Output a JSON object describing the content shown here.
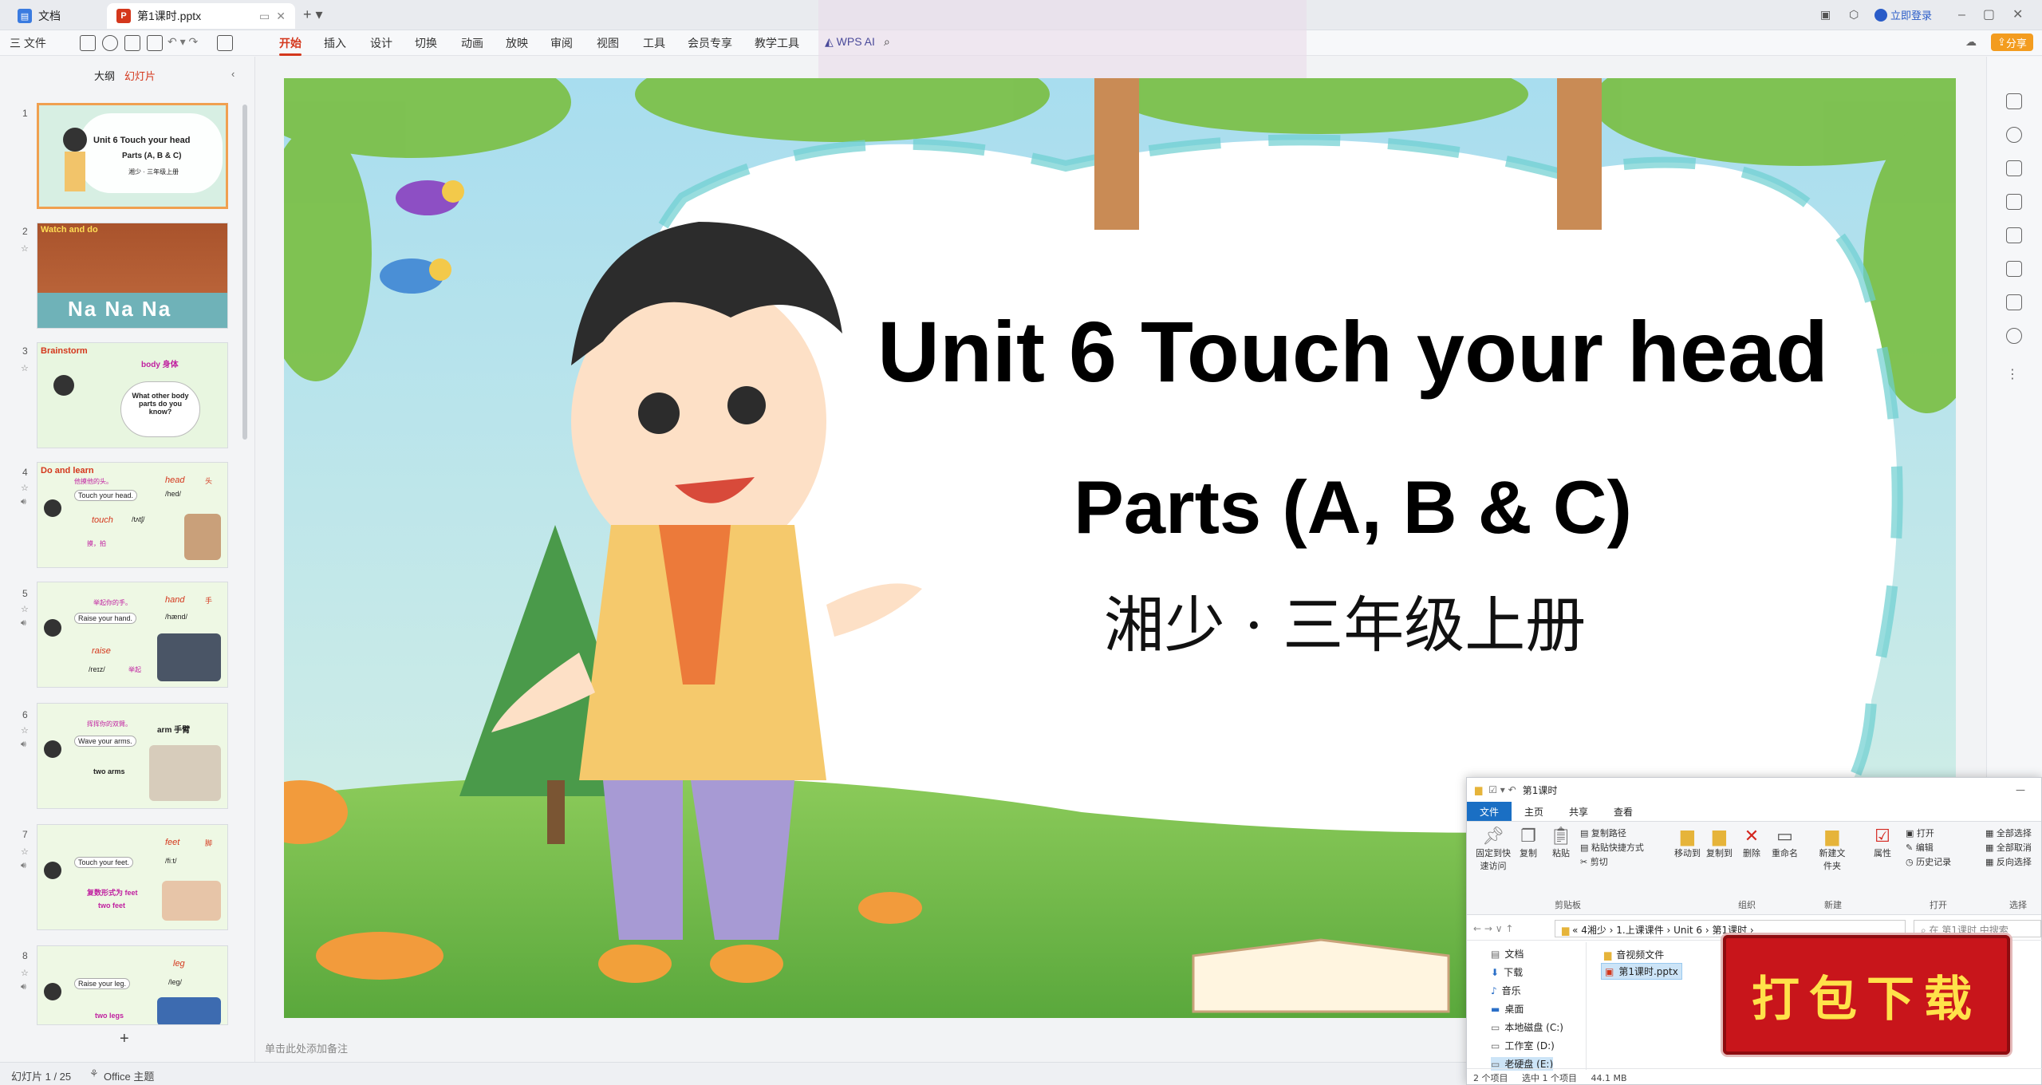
{
  "tabs": {
    "home": "文档",
    "file": "第1课时.pptx",
    "file_icon": "P",
    "login": "立即登录"
  },
  "menu": {
    "file": "三 文件",
    "items": [
      "开始",
      "插入",
      "设计",
      "切换",
      "动画",
      "放映",
      "审阅",
      "视图",
      "工具",
      "会员专享",
      "教学工具"
    ],
    "wps_ai": "WPS AI",
    "share": "分享"
  },
  "left_pane": {
    "tab_outline": "大纲",
    "tab_slides": "幻灯片",
    "add": "+"
  },
  "thumbnails": [
    {
      "num": "1",
      "title": "Unit 6 Touch your head",
      "sub": "Parts (A, B & C)",
      "sub2": "湘少 · 三年级上册"
    },
    {
      "num": "2",
      "title": "Watch and do",
      "word": "Na Na Na"
    },
    {
      "num": "3",
      "title": "Brainstorm",
      "tag": "body 身体",
      "bubble": "What other body parts do you know?"
    },
    {
      "num": "4",
      "title": "Do and learn",
      "cn": "他摸他的头。",
      "phrase": "Touch your head.",
      "word": "head",
      "word_cn": "头",
      "ph1": "/hed/",
      "word2": "touch",
      "ph2": "/tʌtʃ/",
      "cn2": "摸，拍"
    },
    {
      "num": "5",
      "cn": "举起你的手。",
      "phrase": "Raise your hand.",
      "word": "hand",
      "word_cn": "手",
      "ph1": "/hænd/",
      "word2": "raise",
      "ph2": "/reɪz/",
      "cn2": "举起"
    },
    {
      "num": "6",
      "cn": "挥挥你的双臂。",
      "phrase": "Wave your arms.",
      "word": "arm 手臂",
      "extra": "two arms"
    },
    {
      "num": "7",
      "phrase": "Touch your feet.",
      "word": "feet",
      "word_cn": "脚",
      "ph1": "/fiːt/",
      "cn": "复数形式为 feet",
      "extra": "two feet"
    },
    {
      "num": "8",
      "phrase": "Raise your leg.",
      "word": "leg",
      "ph1": "/leg/",
      "extra": "two legs"
    }
  ],
  "slide": {
    "title": "Unit 6 Touch your head",
    "subtitle": "Parts (A, B & C)",
    "publisher": "湘少 · 三年级上册"
  },
  "notes_placeholder": "单击此处添加备注",
  "status": {
    "slide_count": "幻灯片 1 / 25",
    "theme": "Office 主题"
  },
  "explorer": {
    "title": "第1课时",
    "tabs": [
      "文件",
      "主页",
      "共享",
      "查看"
    ],
    "ribbon": {
      "pin": "固定到快速访问",
      "copy": "复制",
      "paste": "粘贴",
      "copy_path": "复制路径",
      "paste_shortcut": "粘贴快捷方式",
      "cut": "剪切",
      "clipboard": "剪贴板",
      "move_to": "移动到",
      "copy_to": "复制到",
      "delete": "删除",
      "rename": "重命名",
      "organize": "组织",
      "new_folder": "新建文件夹",
      "new": "新建",
      "properties": "属性",
      "open": "打开",
      "edit": "编辑",
      "history": "历史记录",
      "open_group": "打开",
      "select_all": "全部选择",
      "select_none": "全部取消",
      "invert": "反向选择",
      "select": "选择"
    },
    "address": "« 4湘少 › 1.上课课件 › Unit 6 › 第1课时 ›",
    "search": "在 第1课时 中搜索",
    "nav": [
      "文档",
      "下载",
      "音乐",
      "桌面",
      "本地磁盘 (C:)",
      "工作室 (D:)",
      "老硬盘 (E:)"
    ],
    "files": [
      "音视频文件",
      "第1课时.pptx"
    ],
    "status_left": "2 个项目",
    "status_sel": "选中 1 个项目",
    "status_size": "44.1 MB"
  },
  "stamp": "打包下载",
  "colors": {
    "accent": "#d4371c",
    "stamp_bg": "#c8151b",
    "stamp_text": "#ffe24a",
    "explorer_tab": "#1a6fc4"
  }
}
